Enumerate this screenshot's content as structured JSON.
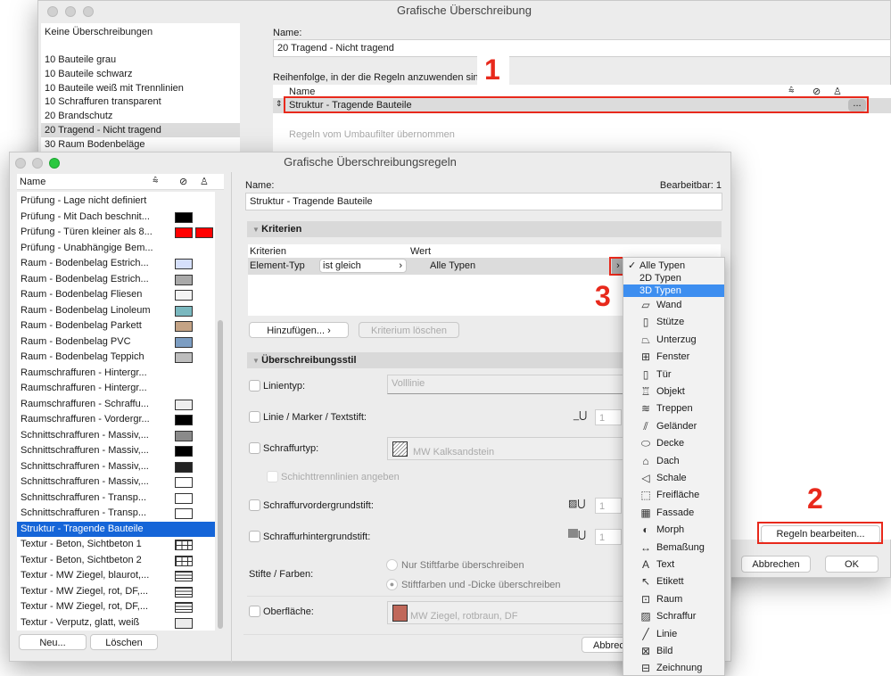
{
  "back_window": {
    "title": "Grafische Überschreibung",
    "list": [
      "Keine Überschreibungen",
      "10 Bauteile grau",
      "10 Bauteile schwarz",
      "10 Bauteile weiß mit Trennlinien",
      "10 Schraffuren transparent",
      "20 Brandschutz",
      "20 Tragend - Nicht tragend",
      "30 Raum Bodenbeläge"
    ],
    "selected_index": 6,
    "name_label": "Name:",
    "name_value": "20 Tragend - Nicht tragend",
    "order_label": "Reihenfolge, in der die Regeln anzuwenden sind:",
    "col_name": "Name",
    "rule_row": "Struktur - Tragende Bauteile",
    "more_button": "...",
    "inherited_text": "Regeln vom Umbaufilter übernommen",
    "edit_rules_button": "Regeln bearbeiten...",
    "cancel_button": "Abbrechen",
    "ok_button": "OK"
  },
  "annotations": {
    "one": "1",
    "two": "2",
    "three": "3"
  },
  "dialog": {
    "title": "Grafische Überschreibungsregeln",
    "list_header": "Name",
    "rules": [
      {
        "name": "Prüfung - Lage nicht definiert",
        "sw": []
      },
      {
        "name": "Prüfung - Mit Dach beschnit...",
        "sw": [
          "#000000"
        ]
      },
      {
        "name": "Prüfung - Türen kleiner als 8...",
        "sw": [
          "#ff0000",
          "#ff0000"
        ]
      },
      {
        "name": "Prüfung - Unabhängige Bem...",
        "sw": []
      },
      {
        "name": "Raum - Bodenbelag Estrich...",
        "sw": [
          "#d6e0fb"
        ]
      },
      {
        "name": "Raum - Bodenbelag Estrich...",
        "sw": [
          "#a9a9a9"
        ]
      },
      {
        "name": "Raum - Bodenbelag Fliesen",
        "sw": [
          "#f4f4f4"
        ]
      },
      {
        "name": "Raum - Bodenbelag Linoleum",
        "sw": [
          "#7ab8bf"
        ]
      },
      {
        "name": "Raum - Bodenbelag Parkett",
        "sw": [
          "#c4a385"
        ]
      },
      {
        "name": "Raum - Bodenbelag PVC",
        "sw": [
          "#7c9dc2"
        ]
      },
      {
        "name": "Raum - Bodenbelag Teppich",
        "sw": [
          "#bdbdbd"
        ]
      },
      {
        "name": "Raumschraffuren - Hintergr...",
        "sw": []
      },
      {
        "name": "Raumschraffuren - Hintergr...",
        "sw": []
      },
      {
        "name": "Raumschraffuren - Schraffu...",
        "sw": [
          "#eeeeee"
        ]
      },
      {
        "name": "Raumschraffuren - Vordergr...",
        "sw": [
          "#000000"
        ]
      },
      {
        "name": "Schnittschraffuren - Massiv,...",
        "sw": [
          "#8a8a8a"
        ]
      },
      {
        "name": "Schnittschraffuren - Massiv,...",
        "sw": [
          "#000000"
        ]
      },
      {
        "name": "Schnittschraffuren - Massiv,...",
        "sw": [
          "#222222"
        ]
      },
      {
        "name": "Schnittschraffuren - Massiv,...",
        "sw": [
          "#ffffff"
        ]
      },
      {
        "name": "Schnittschraffuren - Transp...",
        "sw": [
          "#ffffff"
        ]
      },
      {
        "name": "Schnittschraffuren - Transp...",
        "sw": [
          "#ffffff"
        ]
      },
      {
        "name": "Struktur - Tragende Bauteile",
        "sw": []
      },
      {
        "name": "Textur - Beton, Sichtbeton 1",
        "sw": [
          "grid"
        ]
      },
      {
        "name": "Textur - Beton, Sichtbeton 2",
        "sw": [
          "grid"
        ]
      },
      {
        "name": "Textur - MW Ziegel, blaurot,...",
        "sw": [
          "brick"
        ]
      },
      {
        "name": "Textur - MW Ziegel, rot, DF,...",
        "sw": [
          "brick"
        ]
      },
      {
        "name": "Textur - MW Ziegel, rot, DF,...",
        "sw": [
          "brick"
        ]
      },
      {
        "name": "Textur - Verputz, glatt, weiß",
        "sw": [
          "#ececec"
        ]
      }
    ],
    "selected_index": 21,
    "new_button": "Neu...",
    "delete_button": "Löschen",
    "name_label": "Name:",
    "editable_label": "Bearbeitbar: 1",
    "name_value": "Struktur - Tragende Bauteile",
    "criteria_section": "Kriterien",
    "col_criteria": "Kriterien",
    "col_value": "Wert",
    "crit_field": "Element-Typ",
    "crit_operator": "ist gleich",
    "crit_value": "Alle Typen",
    "add_button": "Hinzufügen...",
    "delete_criterion_button": "Kriterium löschen",
    "style_section": "Überschreibungsstil",
    "line_type_label": "Linientyp:",
    "line_type_value": "Volllinie",
    "pen_label": "Linie / Marker / Textstift:",
    "pen_value": "1",
    "fill_type_label": "Schraffurtyp:",
    "fill_type_value": "MW Kalksandstein",
    "layer_lines_label": "Schichttrennlinien angeben",
    "fg_pen_label": "Schraffurvordergrundstift:",
    "fg_pen_value": "1",
    "bg_pen_label": "Schraffurhintergrundstift:",
    "bg_pen_value": "1",
    "pens_label": "Stifte / Farben:",
    "radio_1": "Nur Stiftfarbe überschreiben",
    "radio_2": "Stiftfarben und -Dicke überschreiben",
    "surface_label": "Oberfläche:",
    "surface_value": "MW Ziegel, rotbraun, DF",
    "surface_color": "#c0685a",
    "cancel_button": "Abbrec"
  },
  "type_menu": {
    "items": [
      {
        "label": "Alle Typen",
        "checked": true,
        "icon": ""
      },
      {
        "label": "2D Typen",
        "icon": ""
      },
      {
        "label": "3D Typen",
        "icon": "",
        "highlight": true
      },
      {
        "label": "Wand",
        "icon": "▱"
      },
      {
        "label": "Stütze",
        "icon": "▯"
      },
      {
        "label": "Unterzug",
        "icon": "⏢"
      },
      {
        "label": "Fenster",
        "icon": "⊞"
      },
      {
        "label": "Tür",
        "icon": "▯"
      },
      {
        "label": "Objekt",
        "icon": "♖"
      },
      {
        "label": "Treppen",
        "icon": "≋"
      },
      {
        "label": "Geländer",
        "icon": "⫽"
      },
      {
        "label": "Decke",
        "icon": "⬭"
      },
      {
        "label": "Dach",
        "icon": "⌂"
      },
      {
        "label": "Schale",
        "icon": "◁"
      },
      {
        "label": "Freifläche",
        "icon": "⬚"
      },
      {
        "label": "Fassade",
        "icon": "▦"
      },
      {
        "label": "Morph",
        "icon": "◐"
      },
      {
        "label": "Bemaßung",
        "icon": "↔"
      },
      {
        "label": "Text",
        "icon": "A"
      },
      {
        "label": "Etikett",
        "icon": "↖"
      },
      {
        "label": "Raum",
        "icon": "⊡"
      },
      {
        "label": "Schraffur",
        "icon": "▨"
      },
      {
        "label": "Linie",
        "icon": "╱"
      },
      {
        "label": "Bild",
        "icon": "⊠"
      },
      {
        "label": "Zeichnung",
        "icon": "⊟"
      }
    ]
  }
}
